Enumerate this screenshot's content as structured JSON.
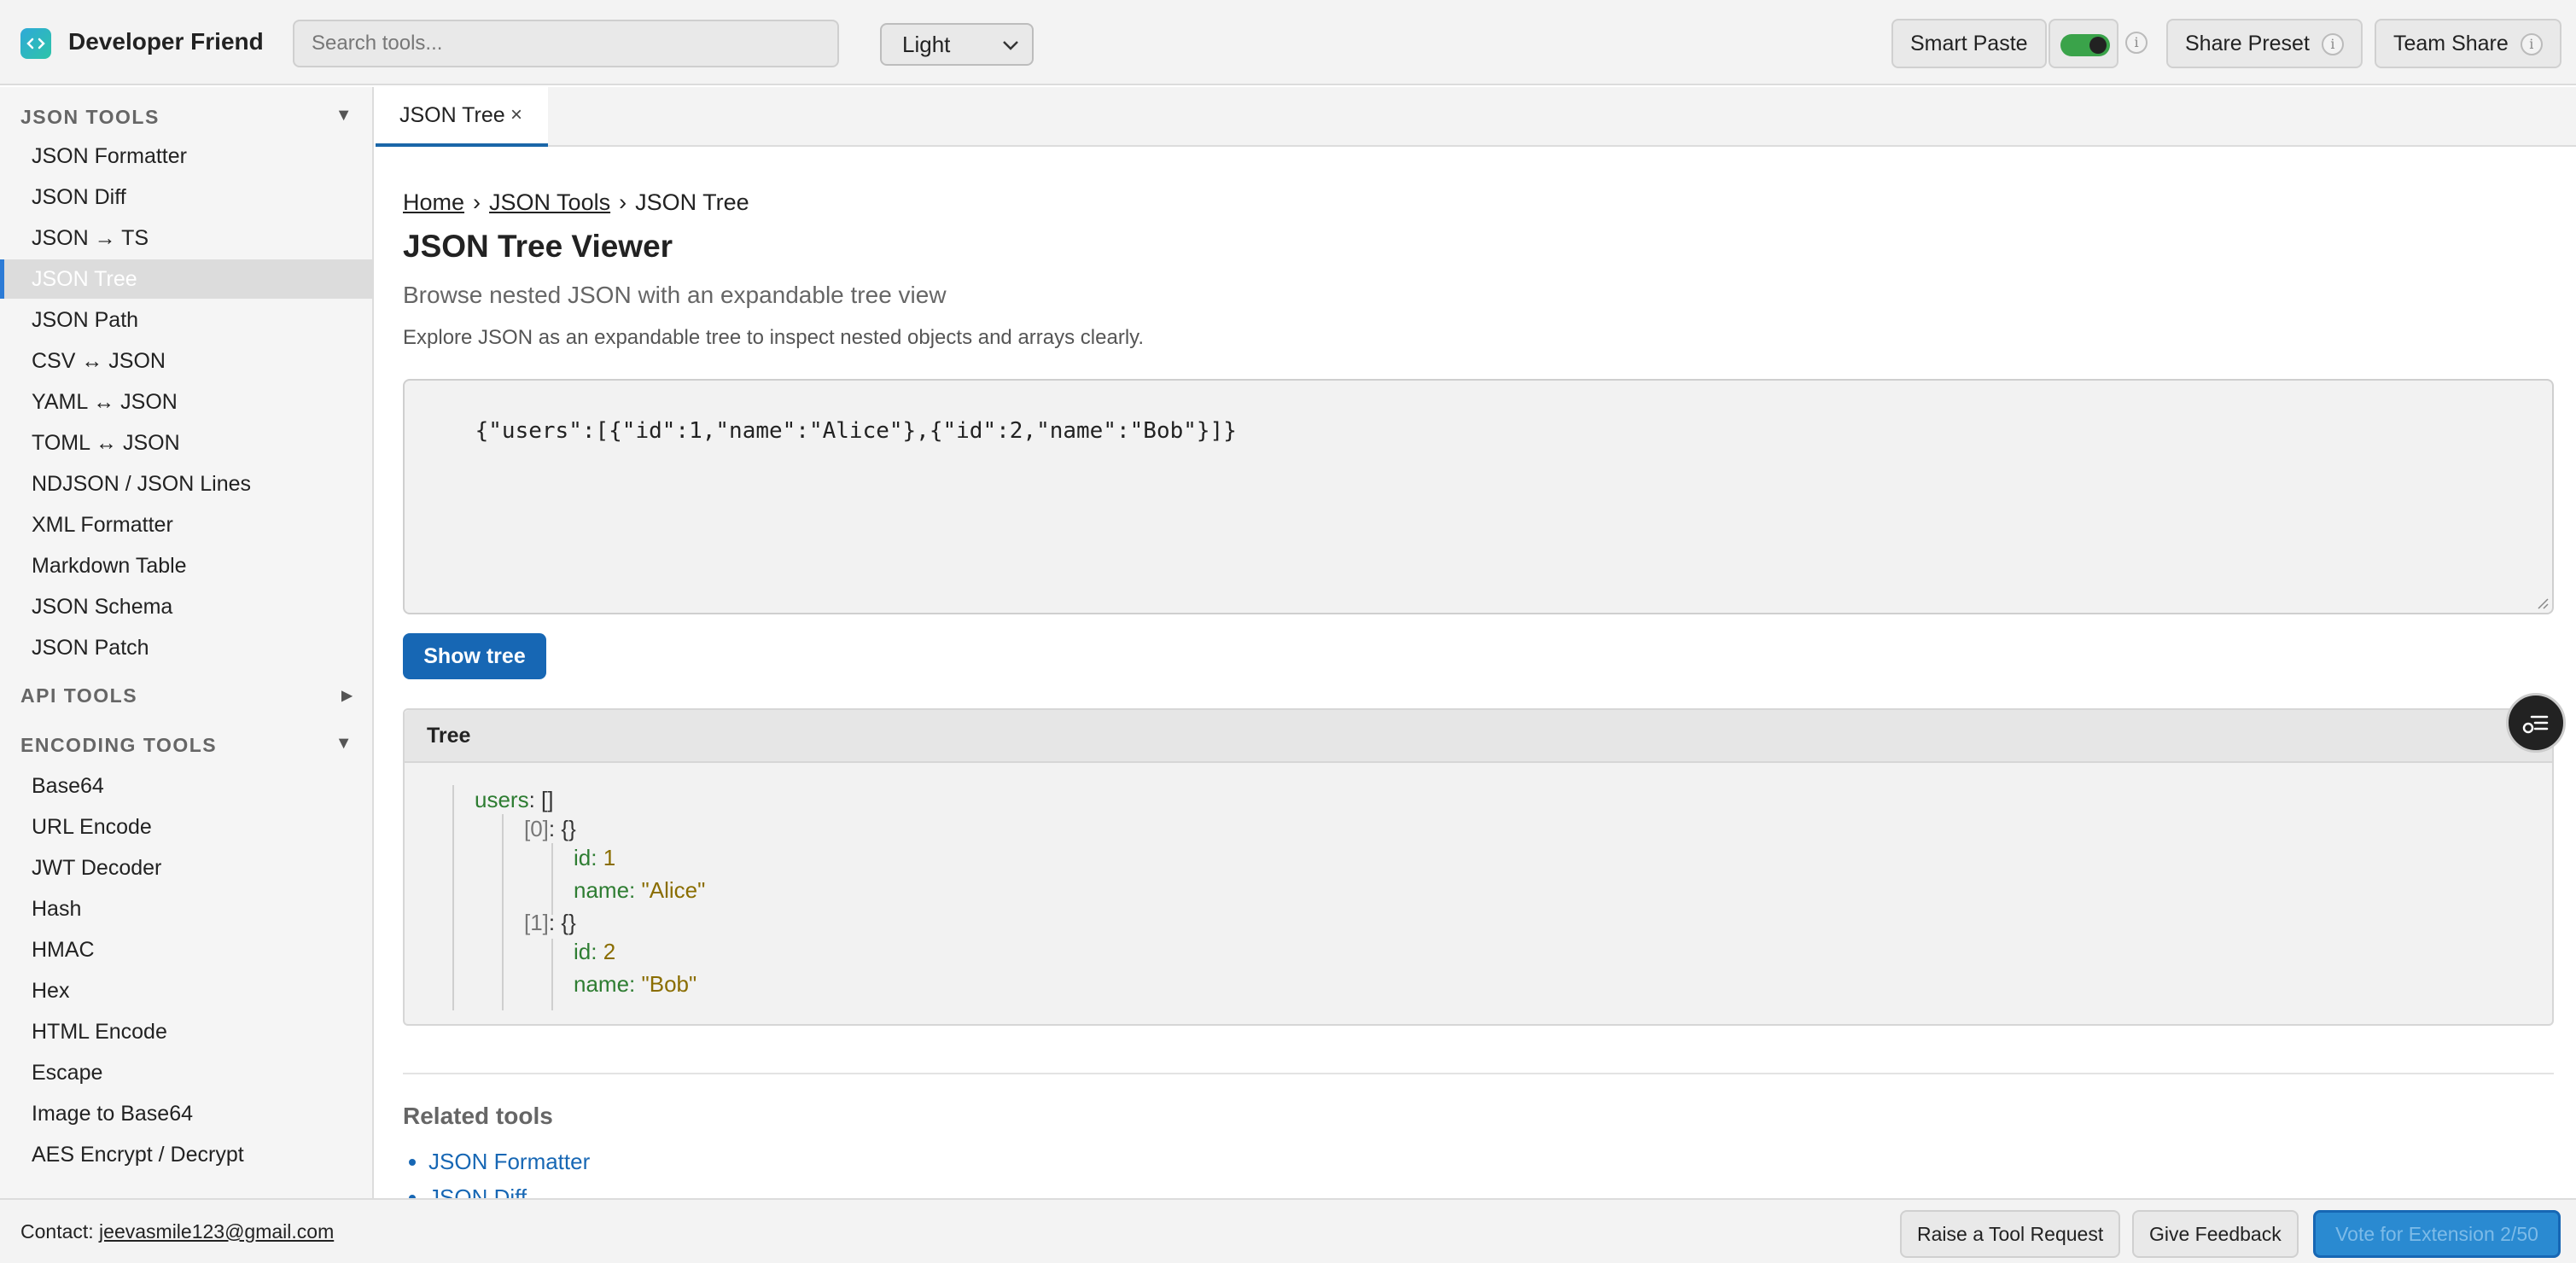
{
  "header": {
    "app_title": "Developer Friend",
    "search_placeholder": "Search tools...",
    "theme": "Light",
    "smart_paste": "Smart Paste",
    "share_preset": "Share Preset",
    "team_share": "Team Share",
    "info": "i",
    "toggle_on": true
  },
  "sidebar": {
    "sections": [
      {
        "title": "JSON TOOLS",
        "expanded": true,
        "items": [
          "JSON Formatter",
          "JSON Diff",
          "JSON → TS",
          "JSON Tree",
          "JSON Path",
          "CSV ↔ JSON",
          "YAML ↔ JSON",
          "TOML ↔ JSON",
          "NDJSON / JSON Lines",
          "XML Formatter",
          "Markdown Table",
          "JSON Schema",
          "JSON Patch"
        ]
      },
      {
        "title": "API TOOLS",
        "expanded": false,
        "items": []
      },
      {
        "title": "ENCODING TOOLS",
        "expanded": true,
        "items": [
          "Base64",
          "URL Encode",
          "JWT Decoder",
          "Hash",
          "HMAC",
          "Hex",
          "HTML Encode",
          "Escape",
          "Image to Base64",
          "AES Encrypt / Decrypt"
        ]
      }
    ],
    "active_item": "JSON Tree",
    "expanded_marker": "▼",
    "collapsed_marker": "▶"
  },
  "tabs": [
    {
      "label": "JSON Tree",
      "close": "×"
    }
  ],
  "main": {
    "breadcrumb": [
      "Home",
      "JSON Tools",
      "JSON Tree"
    ],
    "breadcrumb_sep": "›",
    "title": "JSON Tree Viewer",
    "subtitle": "Browse nested JSON with an expandable tree view",
    "description": "Explore JSON as an expandable tree to inspect nested objects and arrays clearly.",
    "input_value": "{\"users\":[{\"id\":1,\"name\":\"Alice\"},{\"id\":2,\"name\":\"Bob\"}]}",
    "show_button": "Show tree",
    "tree_title": "Tree",
    "tree": {
      "root_key": "users",
      "root_type": "[]",
      "colon": ":",
      "children": [
        {
          "index": "[0]",
          "type": "{}",
          "id_key": "id",
          "id": "1",
          "name_key": "name",
          "name": "\"Alice\""
        },
        {
          "index": "[1]",
          "type": "{}",
          "id_key": "id",
          "id": "2",
          "name_key": "name",
          "name": "\"Bob\""
        }
      ]
    },
    "related_title": "Related tools",
    "related": [
      "JSON Formatter",
      "JSON Diff"
    ]
  },
  "footer": {
    "contact_label": "Contact:",
    "contact_email": "jeevasmile123@gmail.com",
    "raise_request": "Raise a Tool Request",
    "feedback": "Give Feedback",
    "vote": "Vote for Extension  2/50"
  },
  "colors": {
    "primary": "#1767b4",
    "toggle": "#3aa34a",
    "tree_key": "#2e7d32",
    "tree_value": "#8a6d00"
  }
}
